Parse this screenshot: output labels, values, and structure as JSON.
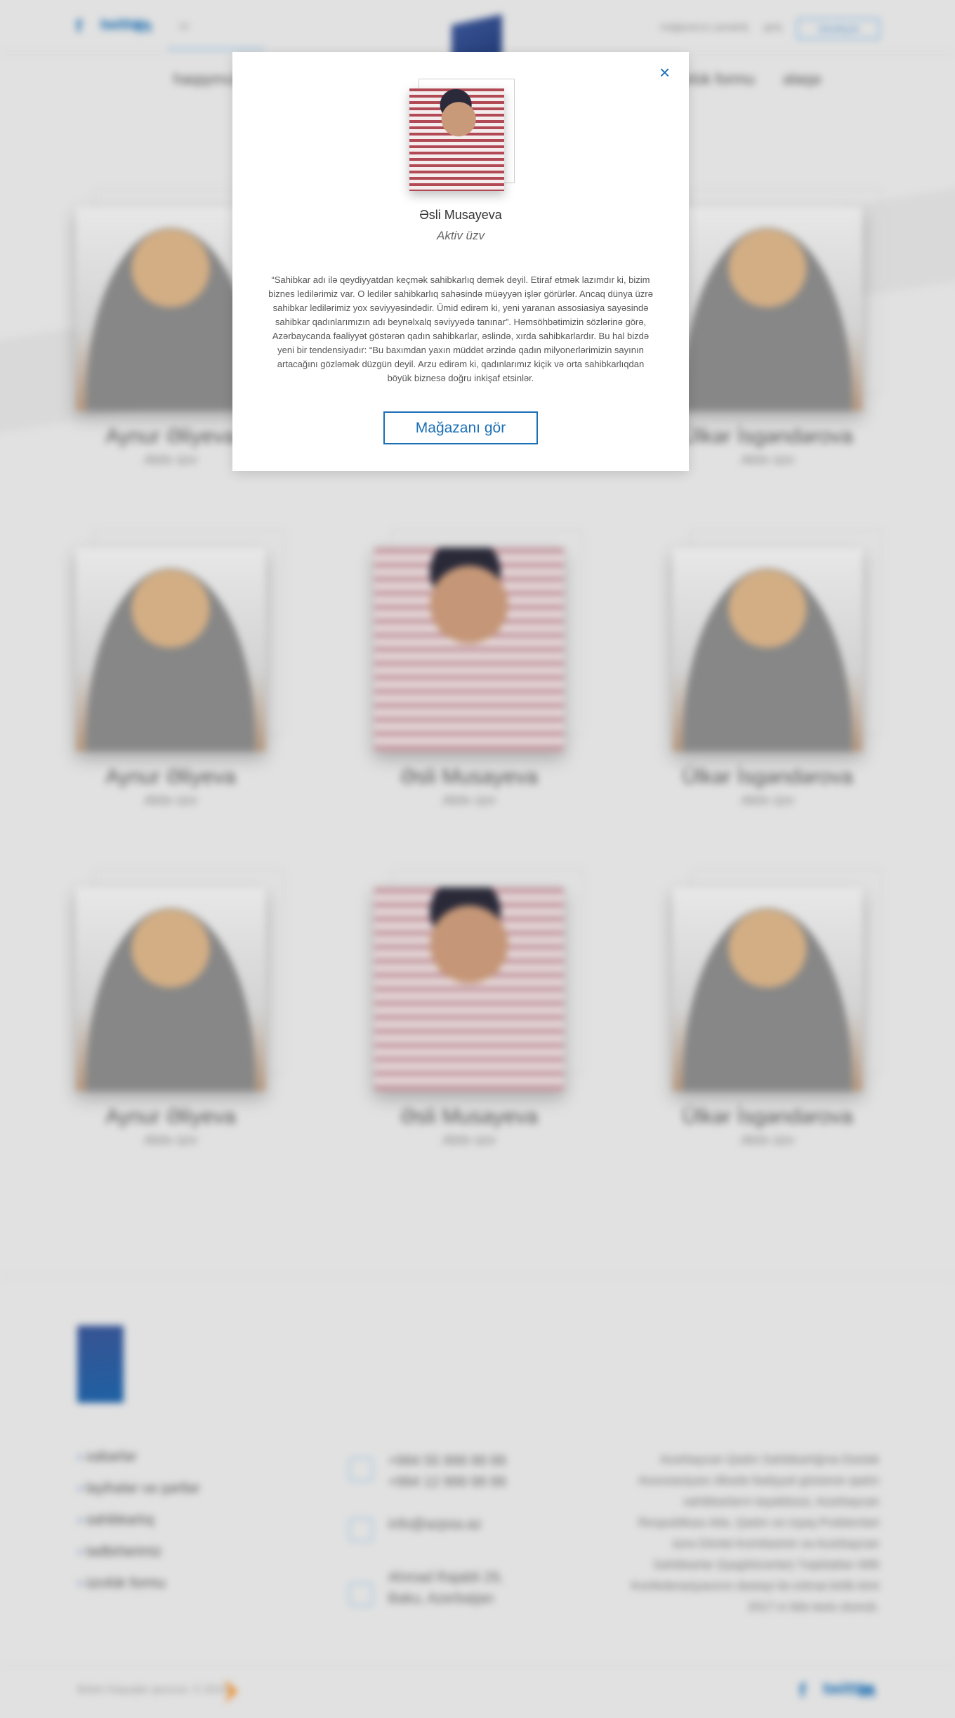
{
  "header": {
    "social": [
      "f",
      "twitter",
      "in"
    ],
    "lang": "az",
    "top_links": [
      "mağazanızı yaradın",
      "|",
      "giriş"
    ],
    "register": "Qeydiyyat",
    "nav": [
      "haqqımızda",
      "üzvlük formu",
      "əlaqə"
    ]
  },
  "cards": [
    {
      "name": "Aynur Əliyeva",
      "role": "Aktiv üzv",
      "photo": "woman-a"
    },
    {
      "name": "Əsli Musayeva",
      "role": "Aktiv üzv",
      "photo": "woman-b"
    },
    {
      "name": "Ülkər İsgəndərova",
      "role": "Aktiv üzv",
      "photo": "woman-a"
    },
    {
      "name": "Aynur Əliyeva",
      "role": "Aktiv üzv",
      "photo": "woman-a"
    },
    {
      "name": "Əsli Musayeva",
      "role": "Aktiv üzv",
      "photo": "woman-b"
    },
    {
      "name": "Ülkər İsgəndərova",
      "role": "Aktiv üzv",
      "photo": "woman-a"
    },
    {
      "name": "Aynur Əliyeva",
      "role": "Aktiv üzv",
      "photo": "woman-a"
    },
    {
      "name": "Əsli Musayeva",
      "role": "Aktiv üzv",
      "photo": "woman-b"
    },
    {
      "name": "Ülkər İsgəndərova",
      "role": "Aktiv üzv",
      "photo": "woman-a"
    }
  ],
  "footer": {
    "menu": [
      "xəbərlər",
      "layihələr və şərtlər",
      "sahibkarlıq",
      "tədbirlərimiz",
      "üzvlük formu"
    ],
    "phone1": "+994 55 999 99 99",
    "phone2": "+994 12 999 99 99",
    "email": "info@azpsa.az",
    "address1": "Ahmad Rajabli 29,",
    "address2": "Baku, Azerbaijan",
    "about": "Azərbaycan Qadın Sahibkarlığına Dəstək Assosiasiyası ölkədə fəaliyyət göstərən qadın sahibkarların təşəbbüsü, Azərbaycan Respublikası Ailə, Qadın və Uşaq Problemləri üzrə Dövlət Komitəsinin və Azərbaycan Sahibkarlar (İşəgötürənlər) Təşkilatları Milli Konfederasiyasının dəstəyi ilə ictimai birlik kimi 2017-ci ildə təsis olunub.",
    "copyright": "Bütün hüquqlar qorunur. © 2018"
  },
  "modal": {
    "close": "×",
    "name": "Əsli Musayeva",
    "role": "Aktiv üzv",
    "quote": "“Sahibkar adı ilə qeydiyyatdan keçmək sahibkarlıq demək deyil. Etiraf etmək lazımdır ki, bizim biznes ledilərimiz var. O ledilər sahibkarlıq sahəsində müəyyən işlər görürlər. Ancaq dünya üzrə sahibkar ledilərimiz yox səviyyəsindədir. Ümid edirəm ki, yeni yaranan assosiasiya sayəsində sahibkar qadınlarımızın adı beynəlxalq səviyyədə tanınar”. Həmsöhbətimizin sözlərinə görə, Azərbaycanda fəaliyyət göstərən qadın sahibkarlar, əslində, xırda sahibkarlardır. Bu hal bizdə yeni bir tendensiyadır: “Bu baxımdan yaxın müddət ərzində qadın milyonerlərimizin sayının artacağını gözləmək düzgün deyil. Arzu edirəm ki, qadınlarımız kiçik və orta sahibkarlıqdan böyük biznesə doğru inkişaf etsinlər.",
    "button": "Mağazanı gör"
  }
}
